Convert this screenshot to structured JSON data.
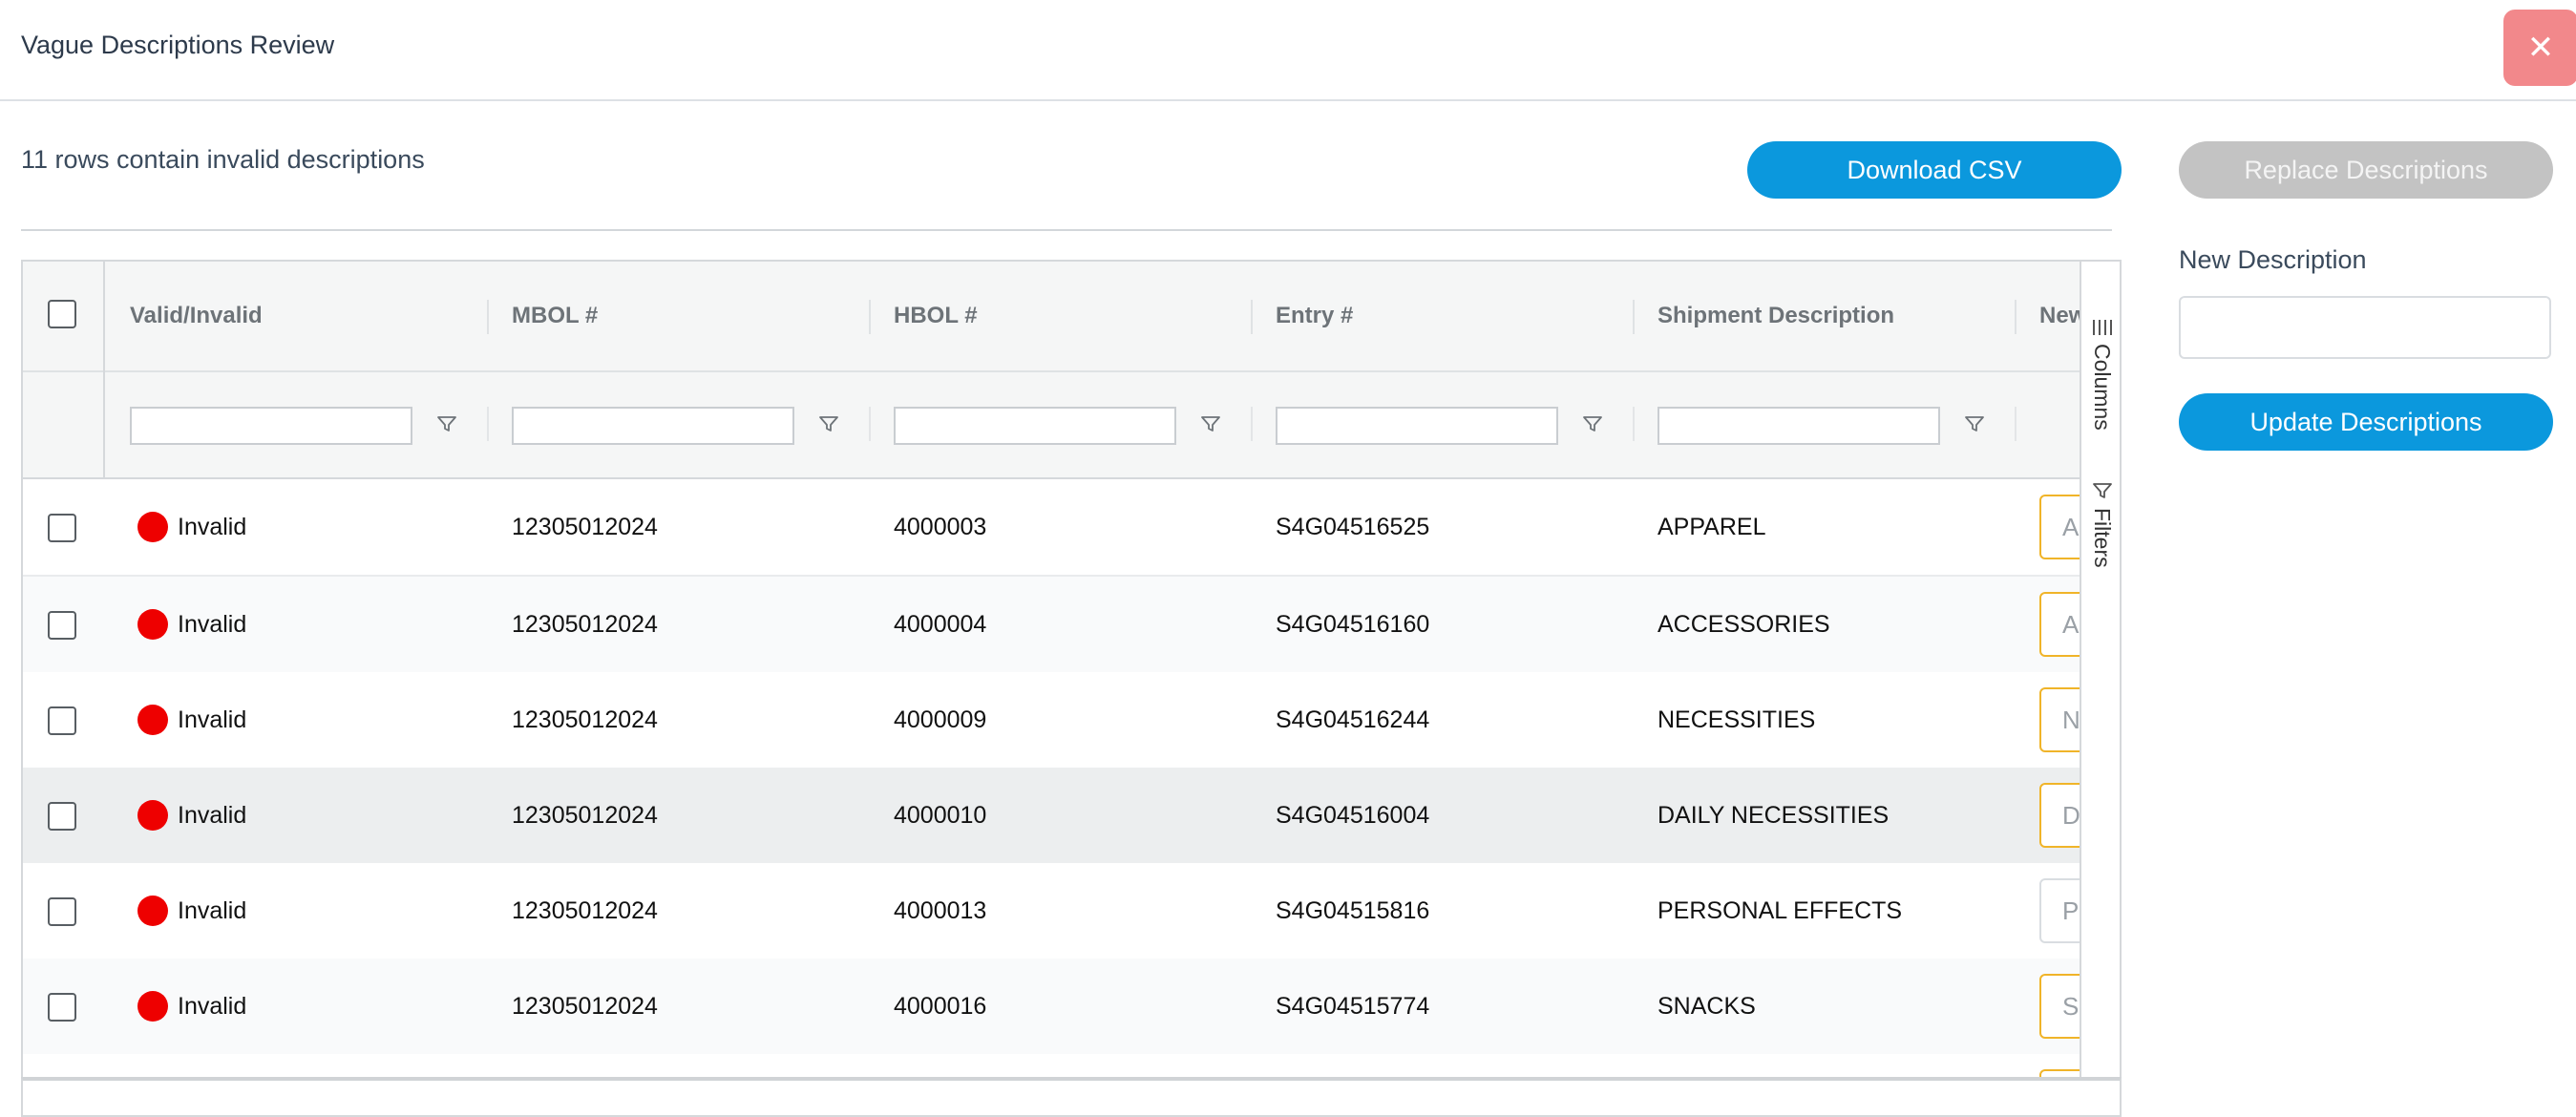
{
  "header": {
    "title": "Vague Descriptions Review",
    "close_glyph": "✕"
  },
  "summary": {
    "invalid_count_text": "11 rows contain invalid descriptions"
  },
  "toolbar": {
    "download_label": "Download CSV",
    "replace_label": "Replace Descriptions"
  },
  "side": {
    "new_description_label": "New Description",
    "new_description_value": "",
    "update_label": "Update Descriptions"
  },
  "grid": {
    "columns": [
      "Valid/Invalid",
      "MBOL #",
      "HBOL #",
      "Entry #",
      "Shipment Description",
      "New"
    ],
    "side_buttons": {
      "columns": "Columns",
      "filters": "Filters"
    },
    "rows": [
      {
        "status": "Invalid",
        "mbol": "12305012024",
        "hbol": "4000003",
        "entry": "S4G04516525",
        "description": "APPAREL",
        "new_preview": "A"
      },
      {
        "status": "Invalid",
        "mbol": "12305012024",
        "hbol": "4000004",
        "entry": "S4G04516160",
        "description": "ACCESSORIES",
        "new_preview": "A"
      },
      {
        "status": "Invalid",
        "mbol": "12305012024",
        "hbol": "4000009",
        "entry": "S4G04516244",
        "description": "NECESSITIES",
        "new_preview": "N"
      },
      {
        "status": "Invalid",
        "mbol": "12305012024",
        "hbol": "4000010",
        "entry": "S4G04516004",
        "description": "DAILY NECESSITIES",
        "new_preview": "D"
      },
      {
        "status": "Invalid",
        "mbol": "12305012024",
        "hbol": "4000013",
        "entry": "S4G04515816",
        "description": "PERSONAL EFFECTS",
        "new_preview": "P"
      },
      {
        "status": "Invalid",
        "mbol": "12305012024",
        "hbol": "4000016",
        "entry": "S4G04515774",
        "description": "SNACKS",
        "new_preview": "S"
      }
    ]
  },
  "colors": {
    "primary": "#0b98dd",
    "invalid_dot": "#ee0000",
    "close_bg": "#f2888b",
    "disabled_bg": "#c3c3c3",
    "warning_border": "#f0b429"
  }
}
